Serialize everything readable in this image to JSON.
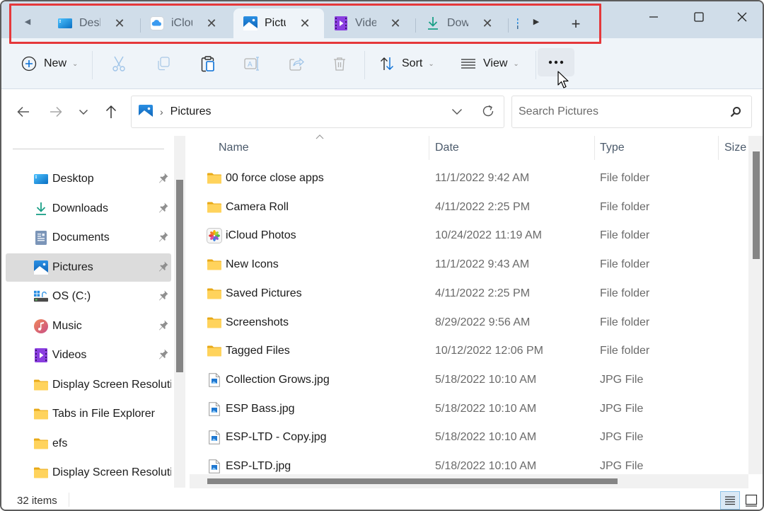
{
  "tabs": {
    "scroll_left_icon": "triangle-left-icon",
    "scroll_right_icon": "triangle-right-icon",
    "items": [
      {
        "label": "Desktop",
        "short": "Desk",
        "icon": "desktop-icon",
        "active": false
      },
      {
        "label": "iCloud Drive",
        "short": "iClou",
        "icon": "icloud-icon",
        "active": false
      },
      {
        "label": "Pictures",
        "short": "Pictu",
        "icon": "pictures-icon",
        "active": true
      },
      {
        "label": "Videos",
        "short": "Vide",
        "icon": "videos-icon",
        "active": false
      },
      {
        "label": "Downloads",
        "short": "Dow",
        "icon": "downloads-icon",
        "active": false
      }
    ],
    "close_glyph": "✕",
    "new_tab_glyph": "+"
  },
  "window_controls": {
    "minimize": "—",
    "maximize": "☐",
    "close": "✕"
  },
  "toolbar": {
    "new_label": "New",
    "sort_label": "Sort",
    "view_label": "View",
    "more_label": "•••",
    "icons": [
      "cut-icon",
      "copy-icon",
      "paste-icon",
      "rename-icon",
      "share-icon",
      "delete-icon"
    ]
  },
  "address": {
    "breadcrumb": [
      "Pictures"
    ],
    "separator": "›"
  },
  "search": {
    "placeholder": "Search Pictures",
    "value": ""
  },
  "sidebar": {
    "items": [
      {
        "label": "Desktop",
        "icon": "desktop-icon",
        "pinned": true,
        "selected": false
      },
      {
        "label": "Downloads",
        "icon": "downloads-icon",
        "pinned": true,
        "selected": false
      },
      {
        "label": "Documents",
        "icon": "documents-icon",
        "pinned": true,
        "selected": false
      },
      {
        "label": "Pictures",
        "icon": "pictures-icon",
        "pinned": true,
        "selected": true
      },
      {
        "label": "OS (C:)",
        "icon": "drive-icon",
        "pinned": true,
        "selected": false
      },
      {
        "label": "Music",
        "icon": "music-icon",
        "pinned": true,
        "selected": false
      },
      {
        "label": "Videos",
        "icon": "videos-icon",
        "pinned": true,
        "selected": false
      },
      {
        "label": "Display Screen Resolution",
        "icon": "folder-icon",
        "pinned": false,
        "selected": false
      },
      {
        "label": "Tabs in File Explorer",
        "icon": "folder-icon",
        "pinned": false,
        "selected": false
      },
      {
        "label": "efs",
        "icon": "folder-icon",
        "pinned": false,
        "selected": false
      },
      {
        "label": "Display Screen Resolution",
        "icon": "folder-icon",
        "pinned": false,
        "selected": false
      }
    ]
  },
  "filelist": {
    "columns": [
      "Name",
      "Date",
      "Type",
      "Size"
    ],
    "sort_column": "Name",
    "rows": [
      {
        "name": "00 force close apps",
        "date": "11/1/2022 9:42 AM",
        "type": "File folder",
        "icon": "folder-icon"
      },
      {
        "name": "Camera Roll",
        "date": "4/11/2022 2:25 PM",
        "type": "File folder",
        "icon": "folder-icon"
      },
      {
        "name": "iCloud Photos",
        "date": "10/24/2022 11:19 AM",
        "type": "File folder",
        "icon": "photos-icon"
      },
      {
        "name": "New Icons",
        "date": "11/1/2022 9:43 AM",
        "type": "File folder",
        "icon": "folder-icon"
      },
      {
        "name": "Saved Pictures",
        "date": "4/11/2022 2:25 PM",
        "type": "File folder",
        "icon": "folder-icon"
      },
      {
        "name": "Screenshots",
        "date": "8/29/2022 9:56 AM",
        "type": "File folder",
        "icon": "folder-icon"
      },
      {
        "name": "Tagged Files",
        "date": "10/12/2022 12:06 PM",
        "type": "File folder",
        "icon": "folder-icon"
      },
      {
        "name": "Collection Grows.jpg",
        "date": "5/18/2022 10:10 AM",
        "type": "JPG File",
        "icon": "image-file-icon"
      },
      {
        "name": "ESP Bass.jpg",
        "date": "5/18/2022 10:10 AM",
        "type": "JPG File",
        "icon": "image-file-icon"
      },
      {
        "name": "ESP-LTD - Copy.jpg",
        "date": "5/18/2022 10:10 AM",
        "type": "JPG File",
        "icon": "image-file-icon"
      },
      {
        "name": "ESP-LTD.jpg",
        "date": "5/18/2022 10:10 AM",
        "type": "JPG File",
        "icon": "image-file-icon"
      }
    ]
  },
  "status": {
    "item_count": "32 items",
    "view_mode": "details"
  },
  "colors": {
    "highlight": "#e5383b",
    "accent": "#0067c0",
    "tabstrip": "#d0dde9"
  }
}
